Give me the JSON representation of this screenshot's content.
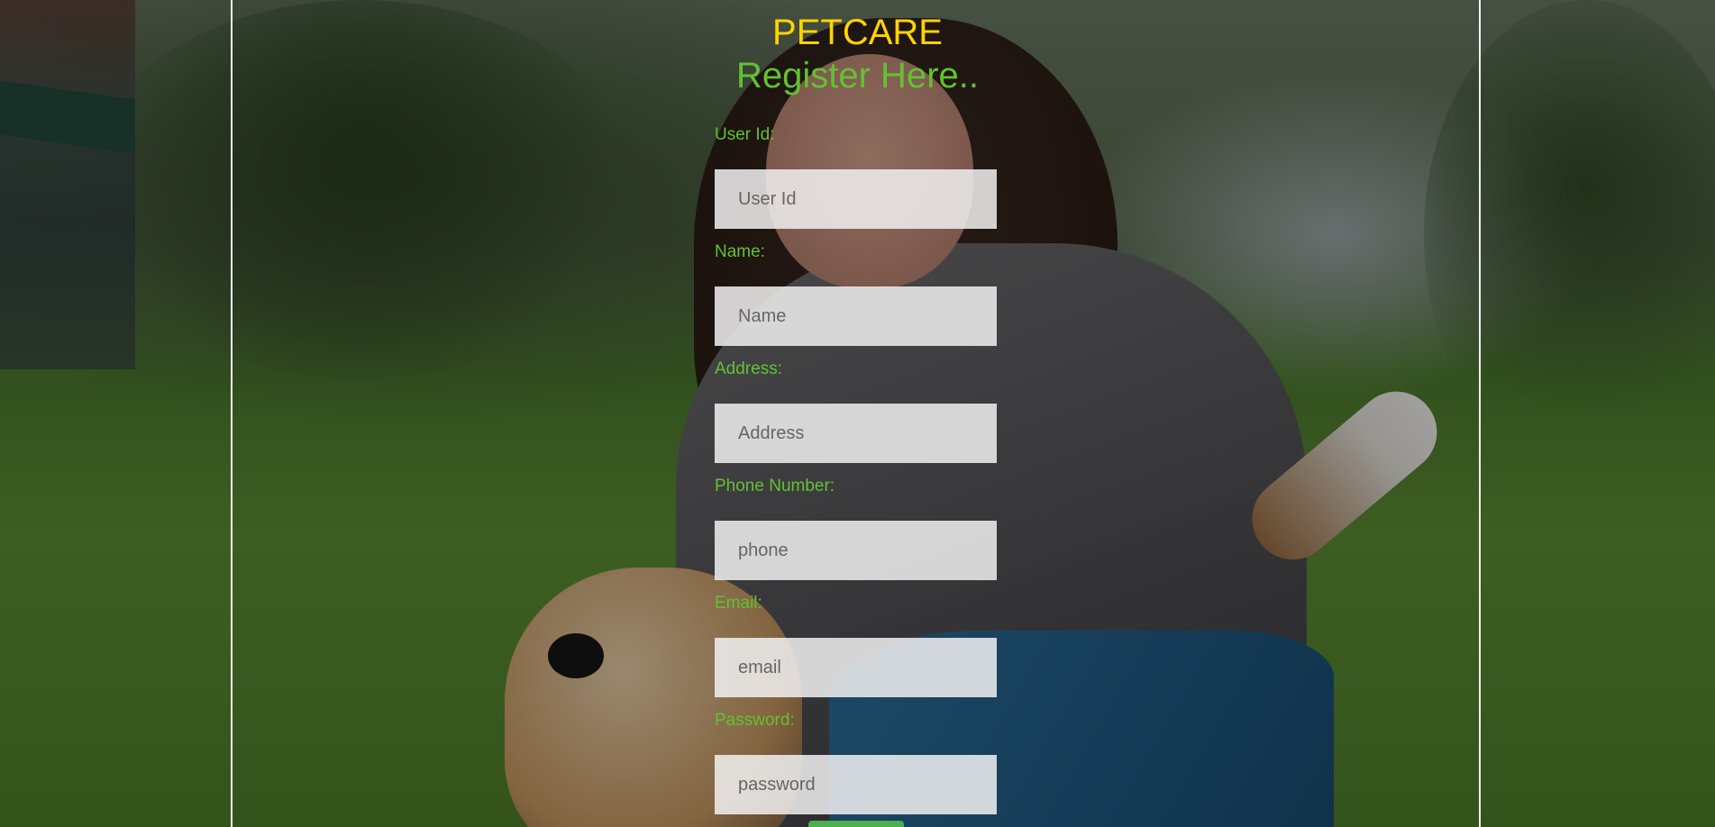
{
  "page": {
    "brand": "PETCARE",
    "heading": "Register Here.."
  },
  "form": {
    "fields": [
      {
        "label": "User Id:",
        "placeholder": "User Id"
      },
      {
        "label": "Name:",
        "placeholder": "Name"
      },
      {
        "label": "Address:",
        "placeholder": "Address"
      },
      {
        "label": "Phone Number:",
        "placeholder": "phone"
      },
      {
        "label": "Email:",
        "placeholder": "email"
      },
      {
        "label": "Password:",
        "placeholder": "password"
      }
    ]
  },
  "colors": {
    "brand": "#ffd400",
    "accent": "#63c132",
    "input_bg": "#f0f0f0"
  }
}
